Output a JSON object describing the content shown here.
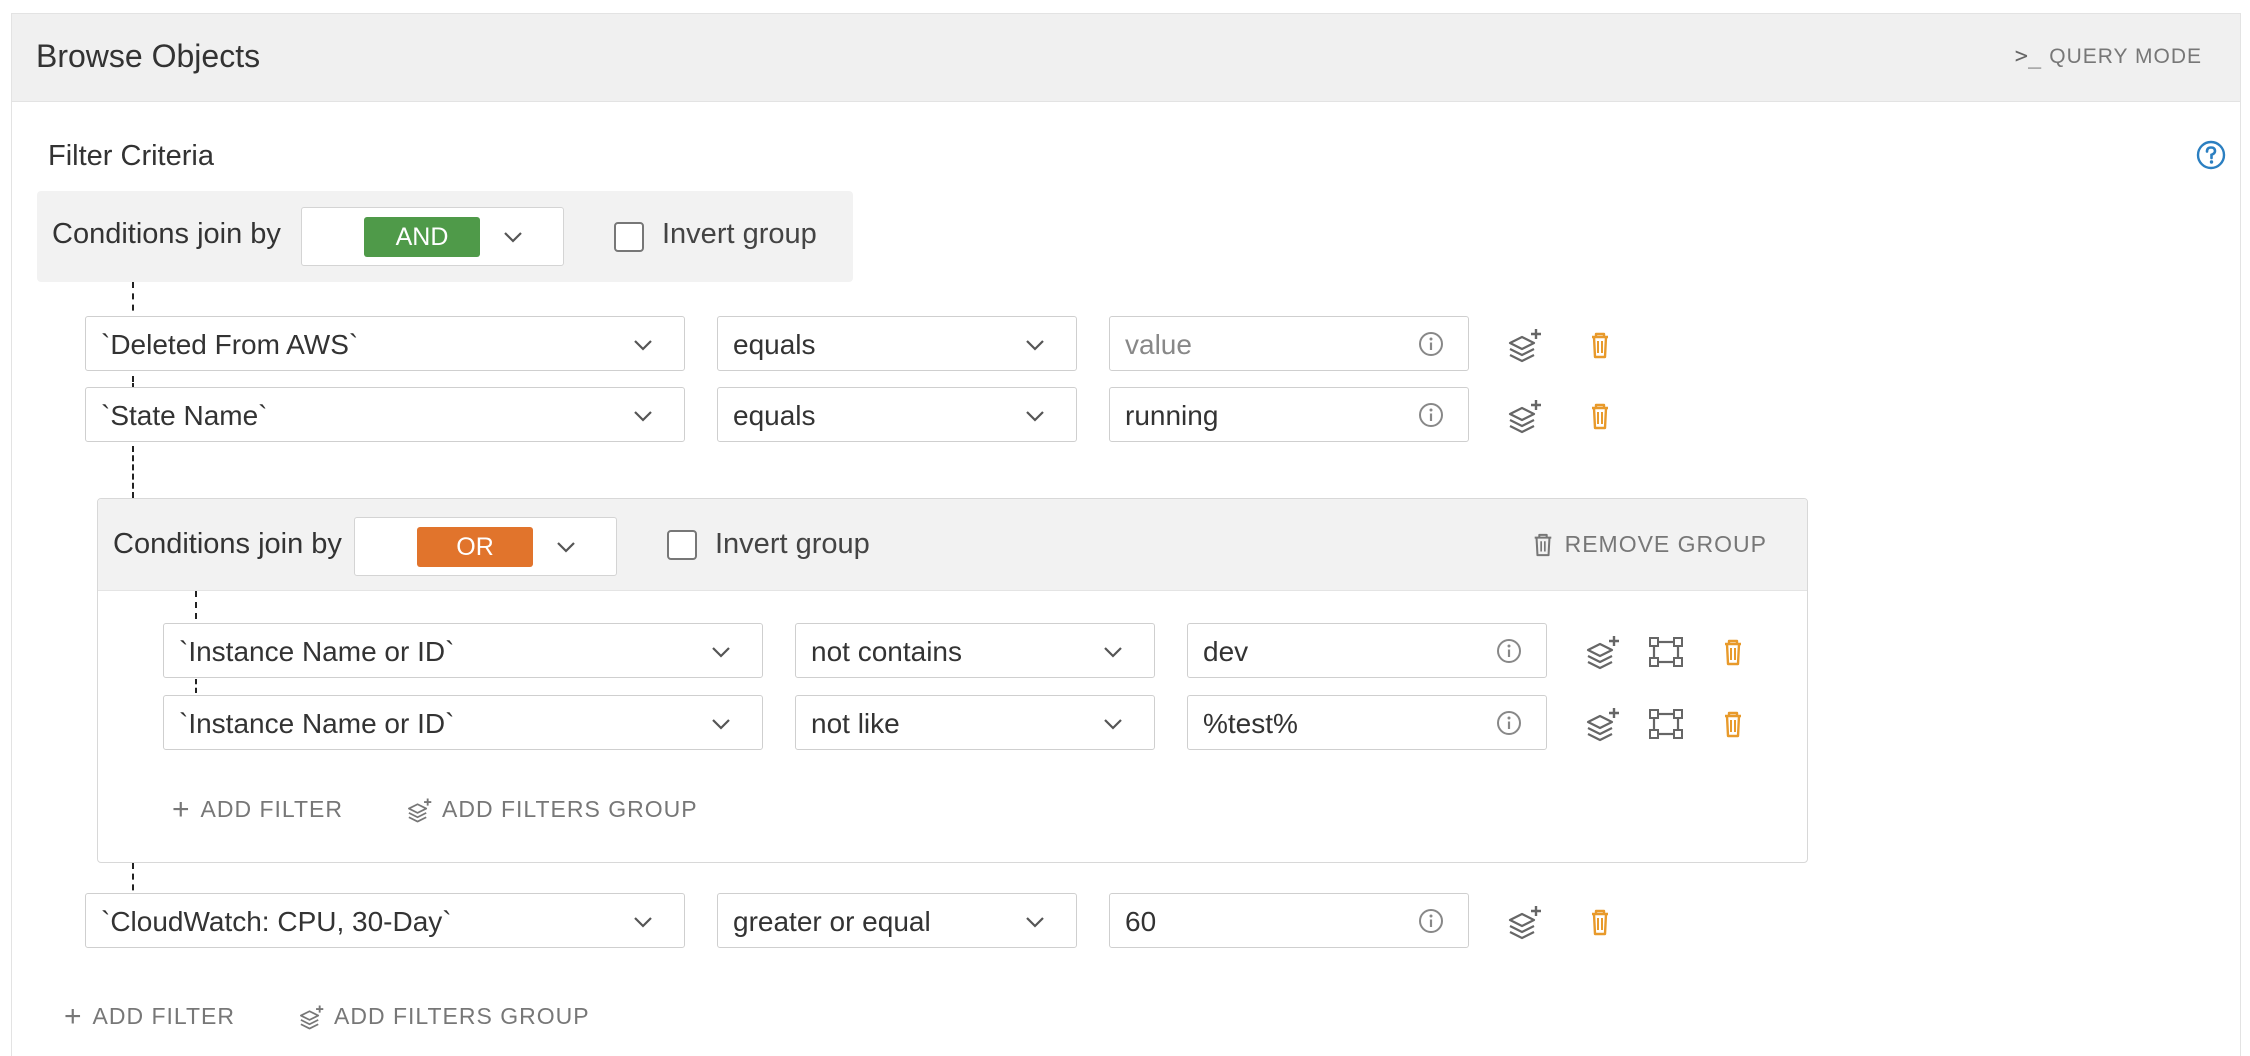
{
  "header": {
    "title": "Browse Objects",
    "query_mode_label": "QUERY MODE",
    "query_mode_icon": "terminal-icon"
  },
  "filter_criteria": {
    "title": "Filter Criteria",
    "help_icon": "help-circle-icon"
  },
  "root_group": {
    "join_label": "Conditions join by",
    "join_value": "AND",
    "join_color": "#4f9a49",
    "invert_label": "Invert group",
    "invert_checked": false,
    "rows": [
      {
        "field": "`Deleted From AWS`",
        "operator": "equals",
        "value": "",
        "value_placeholder": "value"
      },
      {
        "field": "`State Name`",
        "operator": "equals",
        "value": "running",
        "value_placeholder": "value"
      }
    ],
    "last_row": {
      "field": "`CloudWatch: CPU, 30-Day`",
      "operator": "greater or equal",
      "value": "60",
      "value_placeholder": "value"
    },
    "add_filter_label": "ADD FILTER",
    "add_group_label": "ADD FILTERS GROUP"
  },
  "sub_group": {
    "join_label": "Conditions join by",
    "join_value": "OR",
    "join_color": "#e1742c",
    "invert_label": "Invert group",
    "invert_checked": false,
    "remove_label": "REMOVE GROUP",
    "rows": [
      {
        "field": "`Instance Name or ID`",
        "operator": "not contains",
        "value": "dev"
      },
      {
        "field": "`Instance Name or ID`",
        "operator": "not like",
        "value": "%test%"
      }
    ],
    "add_filter_label": "ADD FILTER",
    "add_group_label": "ADD FILTERS GROUP"
  },
  "colors": {
    "delete_icon": "#e89a2b",
    "help_icon": "#2b7fc1"
  }
}
